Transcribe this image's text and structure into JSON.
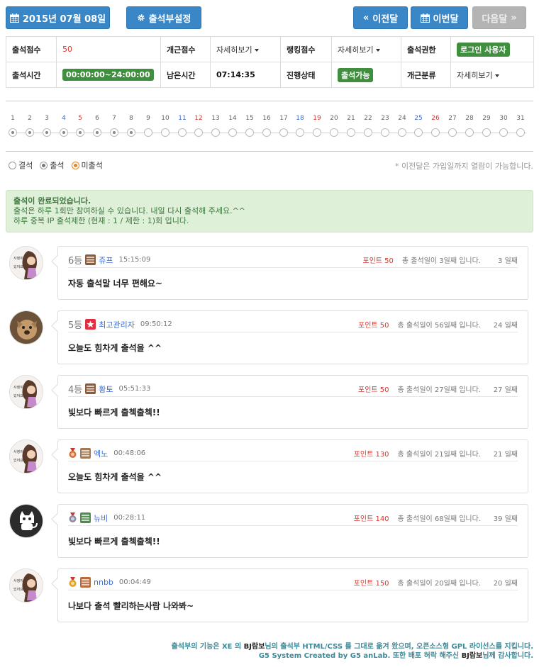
{
  "header": {
    "date_label": "2015년 07월 08일",
    "settings_label": "출석부설정",
    "prev_label": "이전달",
    "this_label": "이번달",
    "next_label": "다음달"
  },
  "info": {
    "score_label": "출석점수",
    "score_value": "50",
    "perfect_label": "개근점수",
    "perfect_value": "자세히보기",
    "ranking_label": "랭킹점수",
    "ranking_value": "자세히보기",
    "auth_label": "출석권한",
    "auth_value": "로그인 사용자",
    "time_label": "출석시간",
    "time_value": "00:00:00~24:00:00",
    "remain_label": "남은시간",
    "remain_value": "07:14:35",
    "status_label": "진행상태",
    "status_value": "출석가능",
    "class_label": "개근분류",
    "class_value": "자세히보기"
  },
  "calendar": {
    "days": [
      "1",
      "2",
      "3",
      "4",
      "5",
      "6",
      "7",
      "8",
      "9",
      "10",
      "11",
      "12",
      "13",
      "14",
      "15",
      "16",
      "17",
      "18",
      "19",
      "20",
      "21",
      "22",
      "23",
      "24",
      "25",
      "26",
      "27",
      "28",
      "29",
      "30",
      "31"
    ],
    "attended_count": 8,
    "saturdays": [
      "4",
      "11",
      "18",
      "25"
    ],
    "sundays": [
      "5",
      "12",
      "19",
      "26"
    ]
  },
  "legend": {
    "absent": "결석",
    "attend": "출석",
    "not_yet": "미출석"
  },
  "note": "* 이전달은 가입일까지 열람이 가능합니다.",
  "alert": {
    "title": "출석이 완료되었습니다.",
    "line1": "출석은 하루 1회만 참여하실 수 있습니다. 내일 다시 출석해 주세요.^^",
    "line2": "하루 중복 IP 출석제한 (현재 : 1 / 제한 : 1)회 입니다."
  },
  "entries": [
    {
      "rank": "6등",
      "name": "쥬프",
      "time": "15:15:09",
      "points": "포인트 50",
      "total": "총 출석일이 3일째 입니다.",
      "streak": "3 일째",
      "message": "자동 출석말 너무 편해요~",
      "avatar": "girl",
      "level": "brown",
      "medal": ""
    },
    {
      "rank": "5등",
      "name": "최고관리자",
      "time": "09:50:12",
      "points": "포인트 50",
      "total": "총 출석일이 56일째 입니다.",
      "streak": "24 일째",
      "message": "오늘도 힘차게 출석을 ^^",
      "avatar": "dog",
      "level": "admin",
      "medal": ""
    },
    {
      "rank": "4등",
      "name": "황토",
      "time": "05:51:33",
      "points": "포인트 50",
      "total": "총 출석일이 27일째 입니다.",
      "streak": "27 일째",
      "message": "빛보다 빠르게 출첵출첵!!",
      "avatar": "girl",
      "level": "brown",
      "medal": ""
    },
    {
      "rank": "",
      "name": "엑노",
      "time": "00:48:06",
      "points": "포인트 130",
      "total": "총 출석일이 21일째 입니다.",
      "streak": "21 일째",
      "message": "오늘도 힘차게 출석을 ^^",
      "avatar": "girl",
      "level": "tan",
      "medal": "bronze"
    },
    {
      "rank": "",
      "name": "뉴비",
      "time": "00:28:11",
      "points": "포인트 140",
      "total": "총 출석일이 68일째 입니다.",
      "streak": "39 일째",
      "message": "빛보다 빠르게 출첵출첵!!",
      "avatar": "cat",
      "level": "green",
      "medal": "silver"
    },
    {
      "rank": "",
      "name": "nnbb",
      "time": "00:04:49",
      "points": "포인트 150",
      "total": "총 출석일이 20일째 입니다.",
      "streak": "20 일째",
      "message": "나보다 출석 빨리하는사람 나와봐~",
      "avatar": "girl",
      "level": "orange",
      "medal": "gold"
    }
  ],
  "footer": {
    "l1a": "출석부의 기능은 XE 의 ",
    "l1b": "BJ람보",
    "l1c": "님의 출석부 HTML/CSS 를 그대로 옮겨 왔으며, 오픈소스형 GPL 라이선스를 지킵니다.",
    "l2a": "G5 System Created by G5 anLab. 또한 배포 허락 해주신 ",
    "l2b": "BJ람보",
    "l2c": "님께 감사합니다."
  }
}
